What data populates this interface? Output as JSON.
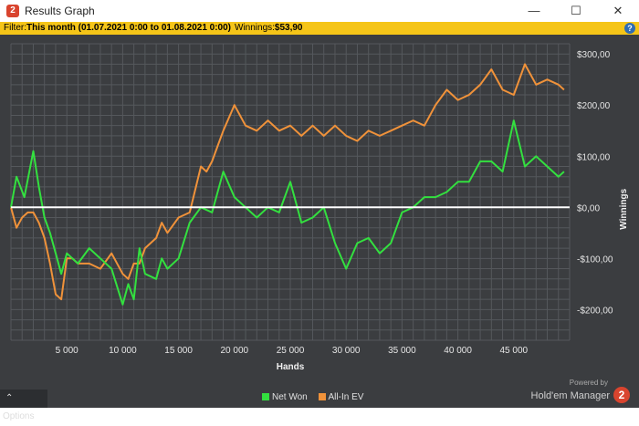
{
  "window": {
    "title": "Results Graph",
    "minimize_glyph": "—",
    "maximize_glyph": "☐",
    "close_glyph": "✕"
  },
  "filter": {
    "prefix": "Filter: ",
    "period": "This month (01.07.2021 0:00 to 01.08.2021 0:00)",
    "winnings_label": "Winnings: ",
    "winnings_value": "$53,90",
    "help_glyph": "?"
  },
  "options": {
    "label": "Options",
    "glyph": "⌃"
  },
  "brand": {
    "powered_by": "Powered by",
    "name": "Hold'em Manager",
    "logo_glyph": "2"
  },
  "colors": {
    "background": "#3b3d40",
    "grid": "#55585c",
    "net_won": "#33e03f",
    "all_in_ev": "#f0923a",
    "zero_line": "#ffffff",
    "filter_bar": "#f5c518",
    "accent": "#d9442e"
  },
  "chart_data": {
    "type": "line",
    "title": "",
    "xlabel": "Hands",
    "ylabel": "Winnings",
    "xlim": [
      0,
      50000
    ],
    "ylim": [
      -260,
      320
    ],
    "x_ticks": [
      5000,
      10000,
      15000,
      20000,
      25000,
      30000,
      35000,
      40000,
      45000
    ],
    "x_tick_labels": [
      "5 000",
      "10 000",
      "15 000",
      "20 000",
      "25 000",
      "30 000",
      "35 000",
      "40 000",
      "45 000"
    ],
    "y_ticks": [
      300,
      200,
      100,
      0,
      -100,
      -200
    ],
    "y_tick_labels": [
      "$300,00",
      "$200,00",
      "$100,00",
      "$0,00",
      "-$100,00",
      "-$200,00"
    ],
    "grid": true,
    "legend_position": "bottom-center",
    "series": [
      {
        "name": "Net Won",
        "x": [
          0,
          500,
          1200,
          2000,
          2500,
          3000,
          3500,
          4000,
          4500,
          5000,
          5500,
          6000,
          7000,
          8000,
          9000,
          10000,
          10500,
          11000,
          11500,
          12000,
          13000,
          13500,
          14000,
          15000,
          16000,
          17000,
          18000,
          19000,
          20000,
          21000,
          22000,
          23000,
          24000,
          25000,
          26000,
          27000,
          28000,
          29000,
          30000,
          31000,
          32000,
          33000,
          34000,
          35000,
          36000,
          37000,
          38000,
          39000,
          40000,
          41000,
          42000,
          43000,
          44000,
          45000,
          46000,
          47000,
          48000,
          49000,
          49500
        ],
        "values": [
          0,
          60,
          20,
          110,
          40,
          -20,
          -50,
          -90,
          -130,
          -90,
          -100,
          -110,
          -80,
          -100,
          -120,
          -190,
          -150,
          -180,
          -80,
          -130,
          -140,
          -100,
          -120,
          -100,
          -30,
          0,
          -10,
          70,
          20,
          0,
          -20,
          0,
          -10,
          50,
          -30,
          -20,
          0,
          -70,
          -120,
          -70,
          -60,
          -90,
          -70,
          -10,
          0,
          20,
          20,
          30,
          50,
          50,
          90,
          90,
          70,
          170,
          80,
          100,
          80,
          60,
          70
        ]
      },
      {
        "name": "All-In EV",
        "x": [
          0,
          500,
          1000,
          1500,
          2000,
          2500,
          3000,
          3500,
          4000,
          4500,
          5000,
          5500,
          6000,
          7000,
          8000,
          9000,
          10000,
          10500,
          11000,
          11500,
          12000,
          13000,
          13500,
          14000,
          15000,
          16000,
          17000,
          17500,
          18000,
          18500,
          19000,
          20000,
          21000,
          22000,
          23000,
          24000,
          25000,
          26000,
          27000,
          28000,
          29000,
          30000,
          31000,
          32000,
          33000,
          34000,
          35000,
          36000,
          37000,
          38000,
          39000,
          40000,
          41000,
          42000,
          43000,
          44000,
          45000,
          46000,
          47000,
          48000,
          49000,
          49500
        ],
        "values": [
          0,
          -40,
          -20,
          -10,
          -10,
          -30,
          -60,
          -110,
          -170,
          -180,
          -100,
          -100,
          -110,
          -110,
          -120,
          -90,
          -130,
          -140,
          -110,
          -110,
          -80,
          -60,
          -30,
          -50,
          -20,
          -10,
          80,
          70,
          90,
          120,
          150,
          200,
          160,
          150,
          170,
          150,
          160,
          140,
          160,
          140,
          160,
          140,
          130,
          150,
          140,
          150,
          160,
          170,
          160,
          200,
          230,
          210,
          220,
          240,
          270,
          230,
          220,
          280,
          240,
          250,
          240,
          230
        ]
      }
    ]
  }
}
